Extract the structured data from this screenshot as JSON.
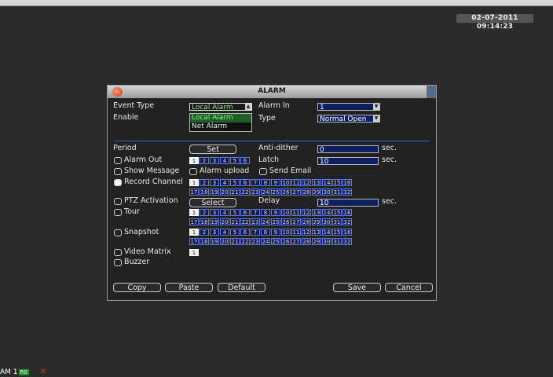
{
  "osd": {
    "datetime": "02-07-2011 09:14:23",
    "status_text": "AM 1",
    "status_badge": "R0"
  },
  "dialog": {
    "title": "ALARM",
    "event_type": {
      "label": "Event Type",
      "value": "Local Alarm",
      "options": [
        "Local Alarm",
        "Net Alarm"
      ]
    },
    "enable_label": "Enable",
    "alarm_in": {
      "label": "Alarm In",
      "value": "1"
    },
    "type": {
      "label": "Type",
      "value": "Normal Open"
    },
    "period": {
      "label": "Period",
      "button": "Set"
    },
    "anti_dither": {
      "label": "Anti-dither",
      "value": "0",
      "unit": "sec."
    },
    "alarm_out": {
      "label": "Alarm Out",
      "channels": [
        "1",
        "2",
        "3",
        "4",
        "5",
        "6"
      ]
    },
    "latch": {
      "label": "Latch",
      "value": "10",
      "unit": "sec."
    },
    "show_message": "Show Message",
    "alarm_upload": "Alarm upload",
    "send_email": "Send Email",
    "record_channel": "Record Channel",
    "ptz_activation": {
      "label": "PTZ Activation",
      "button": "Select"
    },
    "delay": {
      "label": "Delay",
      "value": "10",
      "unit": "sec."
    },
    "tour": "Tour",
    "snapshot": "Snapshot",
    "video_matrix": "Video Matrix",
    "buzzer": "Buzzer",
    "channels_a": [
      "1",
      "2",
      "3",
      "4",
      "5",
      "6",
      "7",
      "8",
      "9",
      "10",
      "11",
      "12",
      "13",
      "14",
      "15",
      "16"
    ],
    "channels_b": [
      "17",
      "18",
      "19",
      "20",
      "21",
      "22",
      "23",
      "24",
      "25",
      "26",
      "27",
      "28",
      "29",
      "30",
      "31",
      "32"
    ],
    "matrix_channels": [
      "1"
    ],
    "buttons": {
      "copy": "Copy",
      "paste": "Paste",
      "default": "Default",
      "save": "Save",
      "cancel": "Cancel"
    }
  }
}
